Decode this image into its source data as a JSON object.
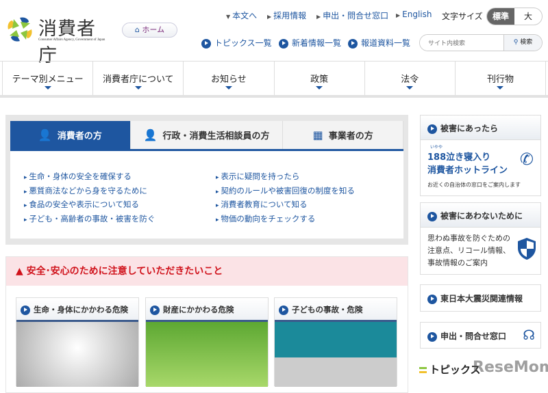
{
  "header": {
    "logo_text": "消費者庁",
    "logo_subtitle": "Consumer Affairs Agency, Government of Japan",
    "home_label": "ホーム",
    "top_links": [
      "本文へ",
      "採用情報",
      "申出・問合せ窓口",
      "English"
    ],
    "font_size_label": "文字サイズ",
    "font_size_options": [
      "標準",
      "大"
    ],
    "sub_links": [
      "トピックス一覧",
      "新着情報一覧",
      "報道資料一覧"
    ],
    "search_placeholder": "サイト内検索",
    "search_button": "検索"
  },
  "nav": [
    "テーマ別メニュー",
    "消費者庁について",
    "お知らせ",
    "政策",
    "法令",
    "刊行物"
  ],
  "tabs": [
    "消費者の方",
    "行政・消費生活相談員の方",
    "事業者の方"
  ],
  "links_left": [
    "生命・身体の安全を確保する",
    "悪質商法などから身を守るために",
    "食品の安全や表示について知る",
    "子ども・高齢者の事故・被害を防ぐ"
  ],
  "links_right": [
    "表示に疑問を持ったら",
    "契約のルールや被害回復の制度を知る",
    "消費者教育について知る",
    "物価の動向をチェックする"
  ],
  "alert": {
    "title": "安全･安心のために注意していただきたいこと",
    "cards": [
      "生命・身体にかかわる危険",
      "財産にかかわる危険",
      "子どもの事故・危険"
    ]
  },
  "sidebar": {
    "box1_title": "被害にあったら",
    "hotline_ruby": "いやや",
    "hotline_line1": "188泣き寝入り",
    "hotline_line2": "消費者ホットライン",
    "hotline_note": "お近くの自治体の窓口をご案内します",
    "box2_title": "被害にあわないために",
    "box2_text": [
      "思わぬ事故を防ぐための",
      "注意点、リコール情報、",
      "事故情報のご案内"
    ],
    "box3_title": "東日本大震災関連情報",
    "box4_title": "申出・問合せ窓口",
    "topics_title": "トピックス"
  },
  "watermark": "ReseMom"
}
